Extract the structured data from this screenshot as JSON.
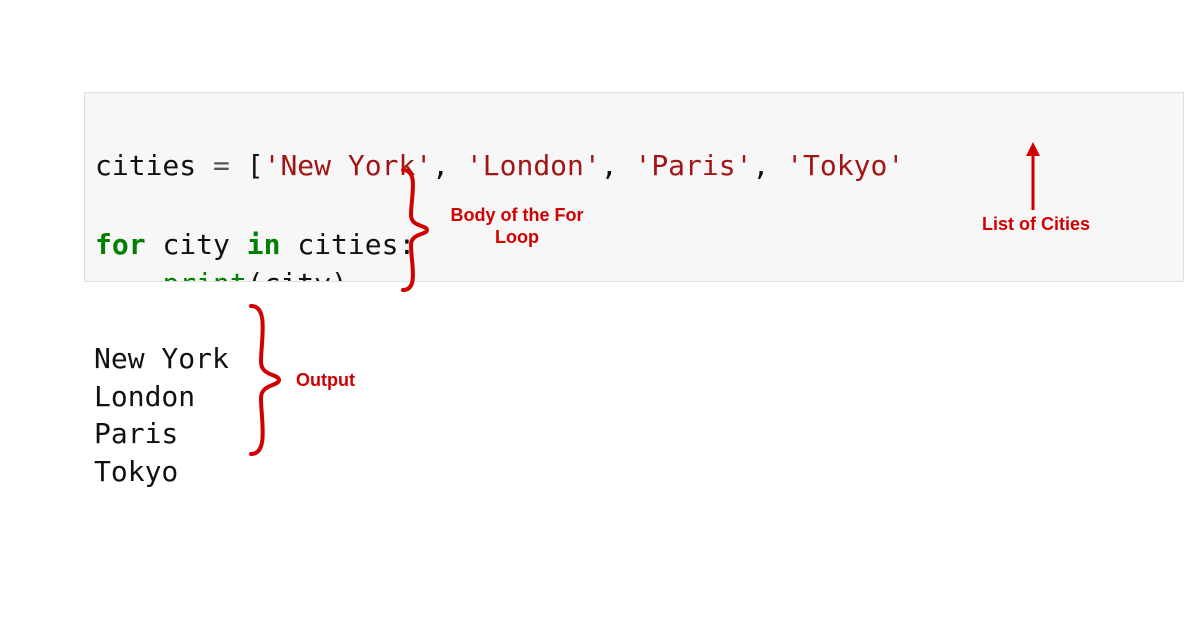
{
  "code": {
    "line1": {
      "var": "cities",
      "eq": " = ",
      "lbr": "[",
      "s1": "'New York'",
      "c1": ", ",
      "s2": "'London'",
      "c2": ", ",
      "s3": "'Paris'",
      "c3": ", ",
      "s4": "'Tokyo'"
    },
    "line2_blank": "",
    "line3": {
      "for": "for",
      "sp1": " ",
      "item": "city",
      "sp2": " ",
      "in": "in",
      "sp3": " ",
      "iter": "cities",
      "colon": ":"
    },
    "line4": {
      "indent": "    ",
      "func": "print",
      "lp": "(",
      "arg": "city",
      "rp": ")"
    }
  },
  "output": {
    "lines": [
      "New York",
      "London",
      "Paris",
      "Tokyo"
    ]
  },
  "annotations": {
    "body": "Body of the For Loop",
    "list": "List of Cities",
    "output": "Output"
  },
  "colors": {
    "annotation": "#d00000"
  }
}
